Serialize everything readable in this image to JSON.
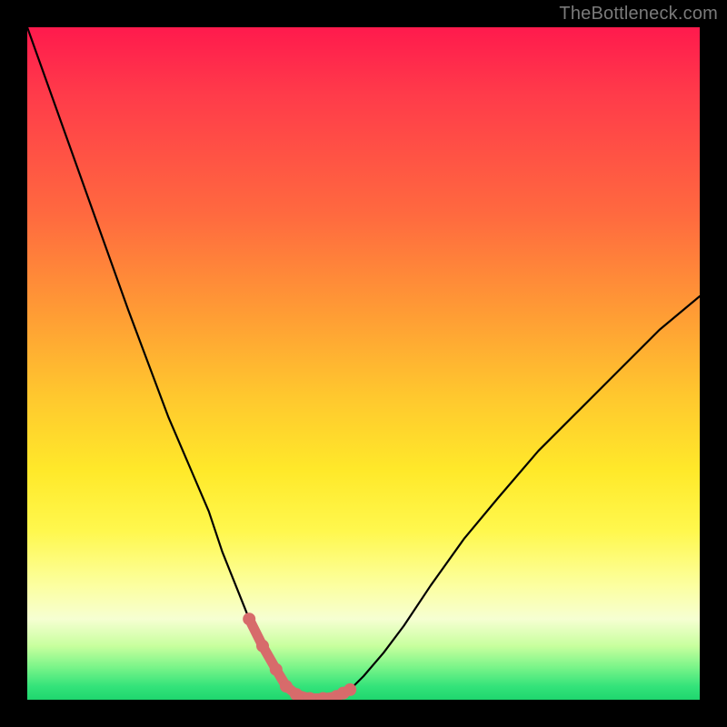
{
  "watermark": {
    "text": "TheBottleneck.com"
  },
  "chart_data": {
    "type": "line",
    "title": "",
    "xlabel": "",
    "ylabel": "",
    "xlim": [
      0,
      100
    ],
    "ylim": [
      0,
      100
    ],
    "grid": false,
    "legend": false,
    "series": [
      {
        "name": "bottleneck-curve",
        "x": [
          0,
          5,
          10,
          15,
          18,
          21,
          24,
          27,
          29,
          31,
          33,
          35,
          37,
          38.5,
          40,
          42,
          44,
          46,
          48,
          50,
          53,
          56,
          60,
          65,
          70,
          76,
          82,
          88,
          94,
          100
        ],
        "values": [
          100,
          86,
          72,
          58,
          50,
          42,
          35,
          28,
          22,
          17,
          12,
          8,
          4.5,
          2,
          0.8,
          0.2,
          0.2,
          0.5,
          1.5,
          3.5,
          7,
          11,
          17,
          24,
          30,
          37,
          43,
          49,
          55,
          60
        ]
      }
    ],
    "markers": {
      "name": "highlight-points",
      "color": "#d76b6b",
      "x": [
        33,
        35,
        37,
        38.5,
        40,
        42,
        44,
        46,
        47,
        48
      ],
      "values": [
        12,
        8,
        4.5,
        2,
        0.8,
        0.2,
        0.2,
        0.5,
        1.0,
        1.5
      ]
    },
    "background_gradient": {
      "axis": "y",
      "stops": [
        {
          "pos": 0,
          "color": "#1fd66e"
        },
        {
          "pos": 5,
          "color": "#7ef58a"
        },
        {
          "pos": 12,
          "color": "#f6ffd2"
        },
        {
          "pos": 25,
          "color": "#fff84e"
        },
        {
          "pos": 45,
          "color": "#ffc82e"
        },
        {
          "pos": 70,
          "color": "#ff6a3f"
        },
        {
          "pos": 100,
          "color": "#ff1a4d"
        }
      ]
    }
  }
}
